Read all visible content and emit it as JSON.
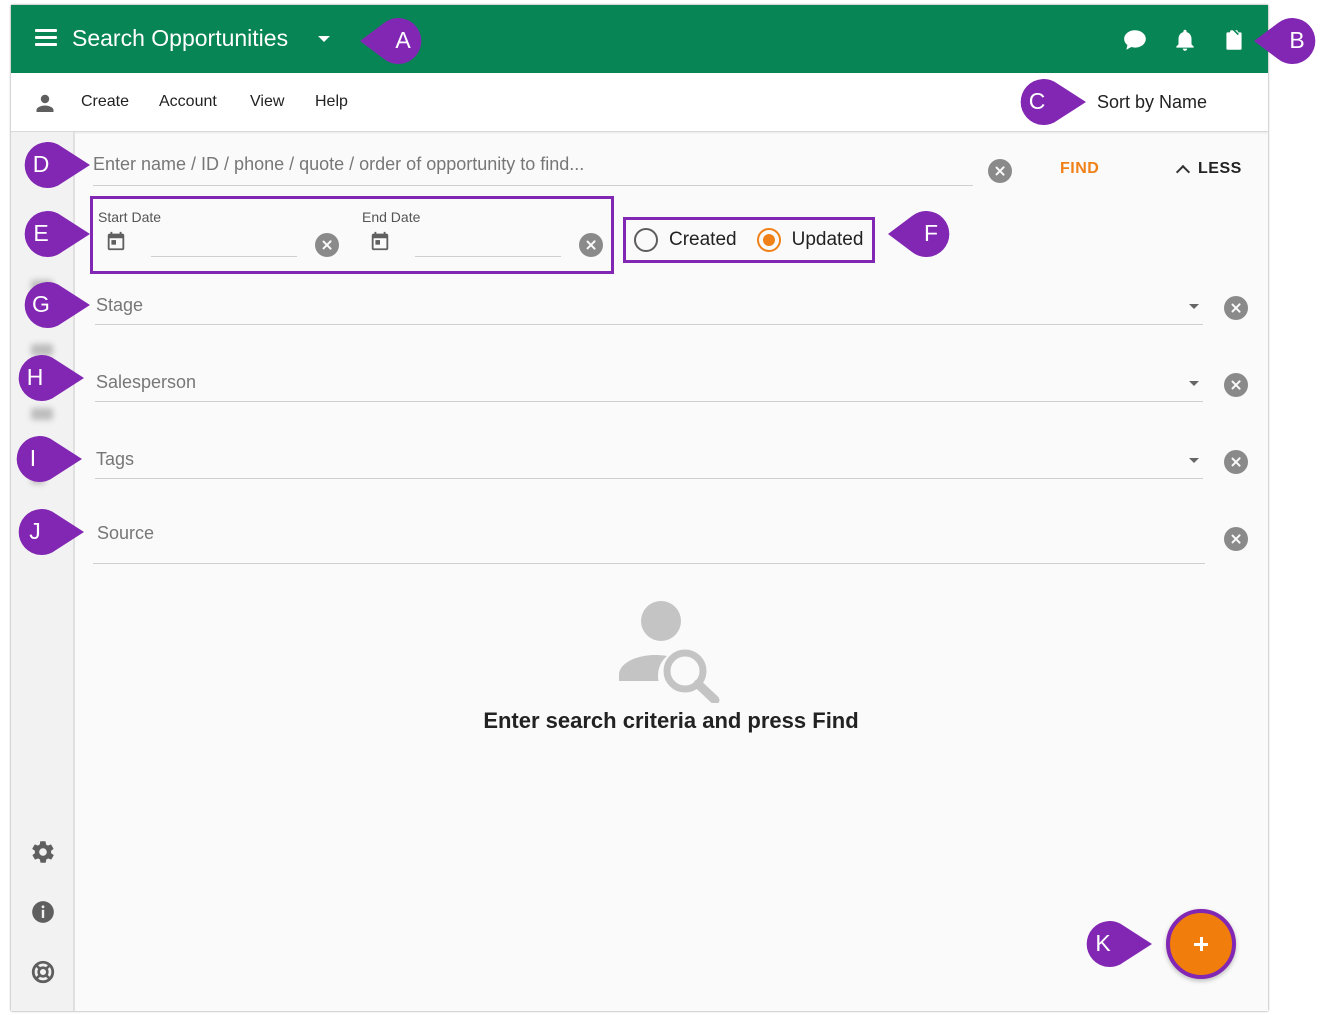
{
  "header": {
    "title": "Search Opportunities",
    "icons": [
      "chat-icon",
      "bell-icon",
      "clipboard-icon"
    ]
  },
  "menu": {
    "items": [
      "Create",
      "Account",
      "View",
      "Help"
    ],
    "sort_label": "Sort by Name"
  },
  "search": {
    "placeholder": "Enter name / ID / phone / quote / order of opportunity to find...",
    "value": "",
    "find_label": "FIND",
    "less_label": "LESS"
  },
  "dates": {
    "start_label": "Start Date",
    "end_label": "End Date",
    "start_value": "",
    "end_value": ""
  },
  "date_type": {
    "options": [
      "Created",
      "Updated"
    ],
    "selected": "Updated"
  },
  "filters": {
    "stage": "Stage",
    "salesperson": "Salesperson",
    "tags": "Tags",
    "source": "Source"
  },
  "empty_state": {
    "message": "Enter search criteria and press Find"
  },
  "sidebar": {
    "icons": [
      "settings-icon",
      "info-icon",
      "help-lifebuoy-icon"
    ]
  },
  "callouts": [
    "A",
    "B",
    "C",
    "D",
    "E",
    "F",
    "G",
    "H",
    "I",
    "J",
    "K"
  ],
  "colors": {
    "header_green": "#078554",
    "accent_orange": "#f08118",
    "callout_purple": "#8227b3"
  }
}
